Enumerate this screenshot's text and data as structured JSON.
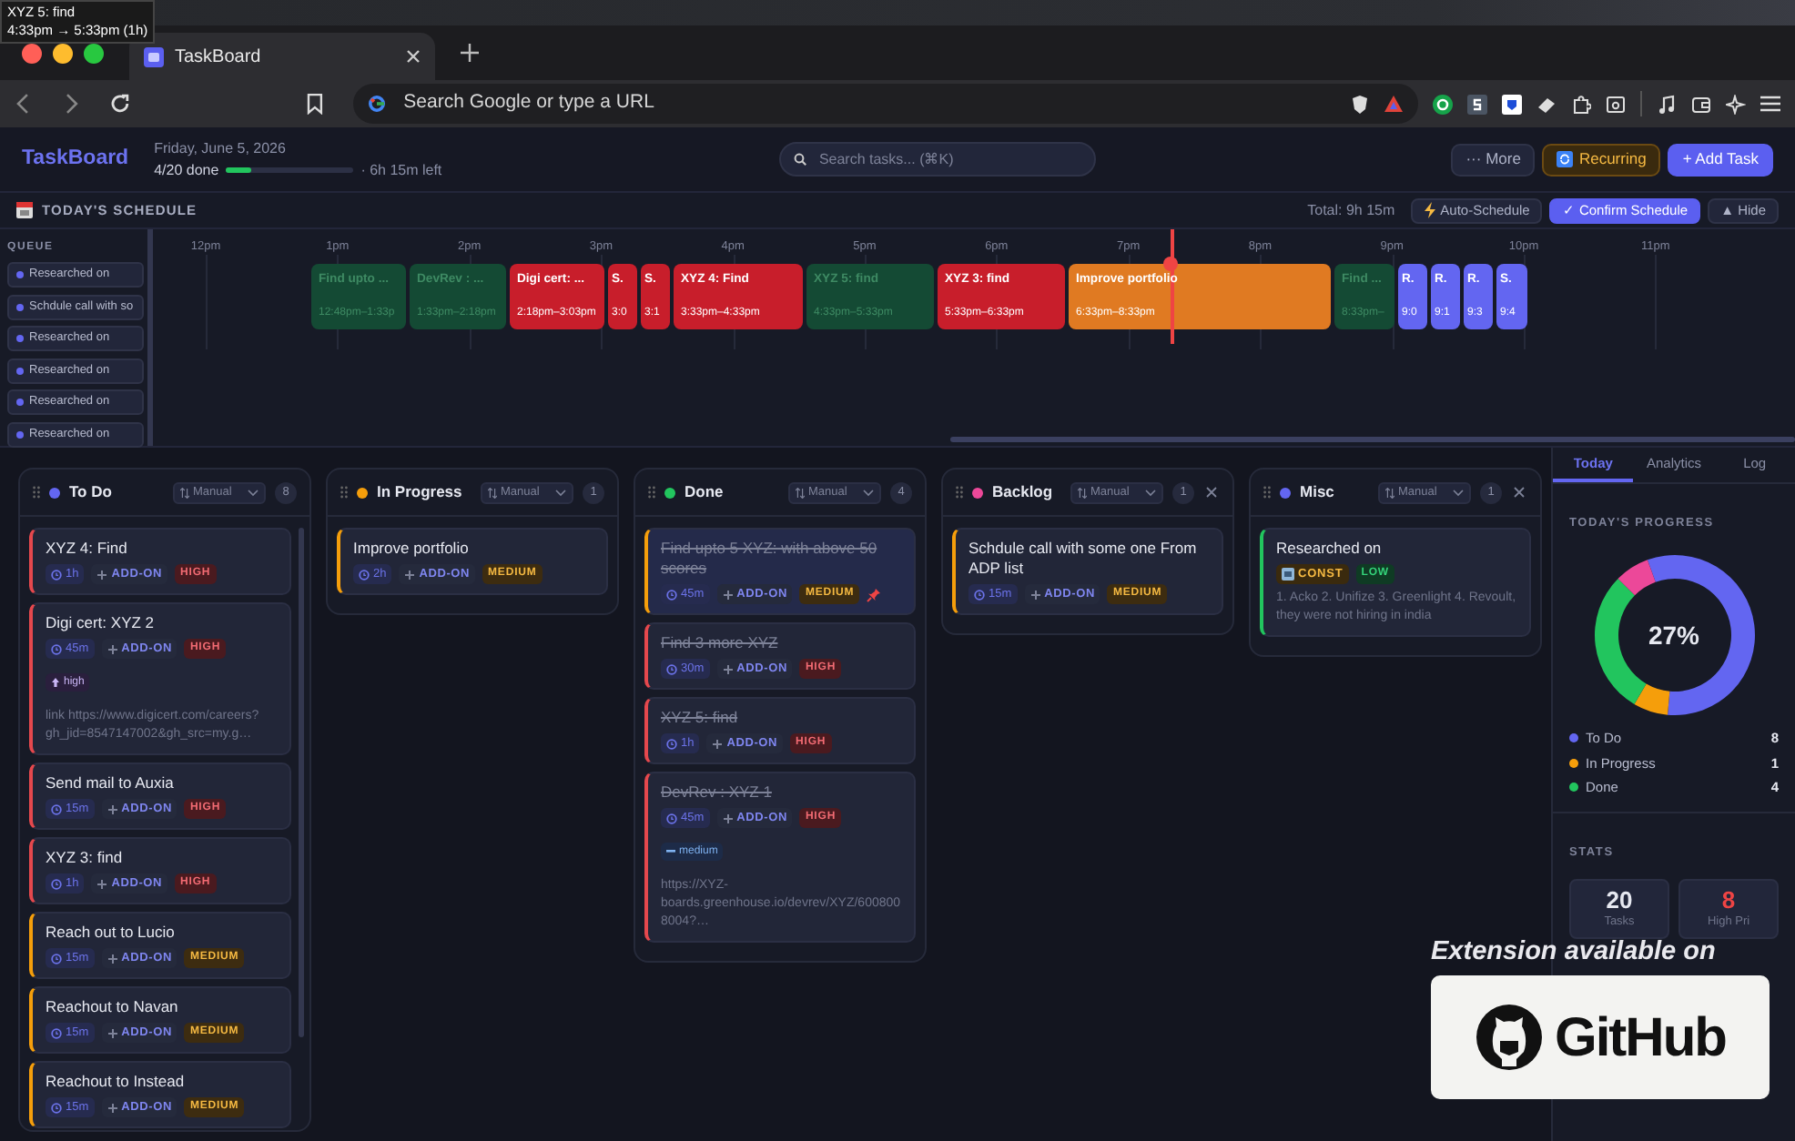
{
  "tooltip": {
    "title": "XYZ 5: find",
    "time": "4:33pm → 5:33pm (1h)"
  },
  "browser": {
    "tab": {
      "title": "TaskBoard",
      "selected": true
    },
    "address": {
      "placeholder": "Search Google or type a URL"
    }
  },
  "header": {
    "logo": "TaskBoard",
    "date": "Friday, June 5, 2026",
    "done": "4/20 done",
    "progress": {
      "level": 0.2
    },
    "remaining": "· 6h 15m left",
    "search": {
      "placeholder": "Search tasks... (⌘K)"
    },
    "buttons": [
      {
        "label": "··· More",
        "kind": "more"
      },
      {
        "label": "Recurring",
        "kind": "recurring"
      },
      {
        "label": "+ Add Task",
        "kind": "primary"
      }
    ]
  },
  "schedule": {
    "title": "TODAY'S SCHEDULE",
    "total": "Total: 9h 15m",
    "buttons": [
      {
        "label": "Auto-Schedule",
        "kind": "auto"
      },
      {
        "label": "✓ Confirm Schedule",
        "kind": "confirm"
      },
      {
        "label": "▲ Hide",
        "kind": "hide"
      }
    ],
    "queue_title": "QUEUE",
    "queue": [
      {
        "label": "Researched on"
      },
      {
        "label": "Schdule call with so"
      },
      {
        "label": "Researched on"
      },
      {
        "label": "Researched on"
      },
      {
        "label": "Researched on"
      },
      {
        "label": "Researched on"
      }
    ],
    "hours": [
      "12pm",
      "1pm",
      "2pm",
      "3pm",
      "4pm",
      "5pm",
      "6pm",
      "7pm",
      "8pm",
      "9pm",
      "10pm",
      "11pm"
    ],
    "blocks": [
      {
        "title": "Find upto ...",
        "time": "12:48pm–1:33p",
        "kind": "done"
      },
      {
        "title": "DevRev : ...",
        "time": "1:33pm–2:18pm",
        "kind": "done"
      },
      {
        "title": "Digi cert: ...",
        "time": "2:18pm–3:03pm",
        "kind": "high"
      },
      {
        "title": "S.",
        "time": "3:0",
        "kind": "high"
      },
      {
        "title": "S.",
        "time": "3:1",
        "kind": "high"
      },
      {
        "title": "XYZ 4: Find",
        "time": "3:33pm–4:33pm",
        "kind": "high"
      },
      {
        "title": "XYZ 5: find",
        "time": "4:33pm–5:33pm",
        "kind": "done"
      },
      {
        "title": "XYZ 3: find",
        "time": "5:33pm–6:33pm",
        "kind": "high"
      },
      {
        "title": "Improve portfolio",
        "time": "6:33pm–8:33pm",
        "kind": "medium"
      },
      {
        "title": "Find ...",
        "time": "8:33pm–",
        "kind": "done"
      },
      {
        "title": "R.",
        "time": "9:0",
        "kind": "misc"
      },
      {
        "title": "R.",
        "time": "9:1",
        "kind": "misc"
      },
      {
        "title": "R.",
        "time": "9:3",
        "kind": "misc"
      },
      {
        "title": "S.",
        "time": "9:4",
        "kind": "misc"
      }
    ]
  },
  "board": {
    "columns": [
      {
        "title": "To Do",
        "color": "#6366f1",
        "sort": "Manual",
        "count": "8",
        "closable": false,
        "cards": [
          {
            "title": "XYZ 4: Find",
            "duration": "1h",
            "type": "ADD-ON",
            "priority": "HIGH",
            "kind": "high",
            "done": false
          },
          {
            "title": "Digi cert: XYZ 2",
            "duration": "45m",
            "type": "ADD-ON",
            "priority": "HIGH",
            "kind": "high",
            "done": false,
            "tag": {
              "label": "high",
              "kind": "up"
            },
            "note": "link https://www.digicert.com/careers?gh_jid=8547147002&gh_src=my.g…"
          },
          {
            "title": "Send mail to Auxia",
            "duration": "15m",
            "type": "ADD-ON",
            "priority": "HIGH",
            "kind": "high",
            "done": false
          },
          {
            "title": "XYZ 3: find",
            "duration": "1h",
            "type": "ADD-ON",
            "priority": "HIGH",
            "kind": "high",
            "done": false
          },
          {
            "title": "Reach out to Lucio",
            "duration": "15m",
            "type": "ADD-ON",
            "priority": "MEDIUM",
            "kind": "medium",
            "done": false
          },
          {
            "title": "Reachout to Navan",
            "duration": "15m",
            "type": "ADD-ON",
            "priority": "MEDIUM",
            "kind": "medium",
            "done": false
          },
          {
            "title": "Reachout to Instead",
            "duration": "15m",
            "type": "ADD-ON",
            "priority": "MEDIUM",
            "kind": "medium",
            "done": false
          }
        ]
      },
      {
        "title": "In Progress",
        "color": "#f59e0b",
        "sort": "Manual",
        "count": "1",
        "closable": false,
        "cards": [
          {
            "title": "Improve portfolio",
            "duration": "2h",
            "type": "ADD-ON",
            "priority": "MEDIUM",
            "kind": "medium",
            "done": false
          }
        ]
      },
      {
        "title": "Done",
        "color": "#22c55e",
        "sort": "Manual",
        "count": "4",
        "closable": false,
        "cards": [
          {
            "title": "Find upto 5 XYZ: with above 50 scores",
            "duration": "45m",
            "type": "ADD-ON",
            "priority": "MEDIUM",
            "kind": "medium",
            "done": true,
            "pinned": true
          },
          {
            "title": "Find 3 more XYZ",
            "duration": "30m",
            "type": "ADD-ON",
            "priority": "HIGH",
            "kind": "high",
            "done": true
          },
          {
            "title": "XYZ 5: find",
            "duration": "1h",
            "type": "ADD-ON",
            "priority": "HIGH",
            "kind": "high",
            "done": true
          },
          {
            "title": "DevRev : XYZ 1",
            "duration": "45m",
            "type": "ADD-ON",
            "priority": "HIGH",
            "kind": "high",
            "done": true,
            "tag": {
              "label": "medium",
              "kind": "flat"
            },
            "note": "https://XYZ-boards.greenhouse.io/devrev/XYZ/6008008004?…"
          }
        ]
      },
      {
        "title": "Backlog",
        "color": "#ec4899",
        "sort": "Manual",
        "count": "1",
        "closable": true,
        "cards": [
          {
            "title": "Schdule call with some one From ADP list",
            "duration": "15m",
            "type": "ADD-ON",
            "priority": "MEDIUM",
            "kind": "medium",
            "done": false
          }
        ]
      },
      {
        "title": "Misc",
        "color": "#6366f1",
        "sort": "Manual",
        "count": "1",
        "closable": true,
        "cards": [
          {
            "title": "Researched on",
            "category": "CONST",
            "priority": "LOW",
            "kind": "low",
            "done": false,
            "note": "1. Acko 2. Unifize 3. Greenlight 4. Revoult, they were not hiring in india"
          }
        ]
      }
    ]
  },
  "panel": {
    "tabs": [
      {
        "label": "Today",
        "selected": true
      },
      {
        "label": "Analytics",
        "selected": false
      },
      {
        "label": "Log",
        "selected": false
      }
    ],
    "progress_title": "TODAY'S PROGRESS",
    "center_label": "27%",
    "chart_data": {
      "type": "donut",
      "values": [
        57,
        7,
        29,
        7
      ],
      "colors": [
        "#6366f1",
        "#f59e0b",
        "#22c55e",
        "#ec4899"
      ]
    },
    "legend": [
      {
        "label": "To Do",
        "value": "8",
        "color": "#6366f1"
      },
      {
        "label": "In Progress",
        "value": "1",
        "color": "#f59e0b"
      },
      {
        "label": "Done",
        "value": "4",
        "color": "#22c55e"
      }
    ],
    "stats_title": "STATS",
    "stats": [
      {
        "value": "20",
        "label": "Tasks",
        "kind": "normal"
      },
      {
        "value": "8",
        "label": "High Pri",
        "kind": "alert"
      }
    ]
  },
  "promo": {
    "caption": "Extension available on",
    "brand": "GitHub"
  }
}
